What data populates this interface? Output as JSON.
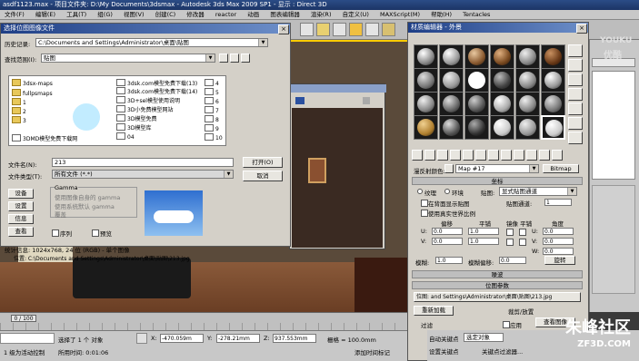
{
  "app": {
    "title": "asdf1123.max - 项目文件夹: D:\\My Documents\\3dsmax - Autodesk 3ds Max 2009 SP1 - 显示 : Direct 3D",
    "menu": [
      "文件(F)",
      "编辑(E)",
      "工具(T)",
      "组(G)",
      "视图(V)",
      "创建(C)",
      "修改器",
      "reactor",
      "动画",
      "图表编辑器",
      "渲染(R)",
      "自定义(U)",
      "MAXScript(M)",
      "帮助(H)",
      "Tentacles"
    ]
  },
  "file_dialog": {
    "title": "选择位图图像文件",
    "history_label": "历史记录:",
    "history_value": "C:\\Documents and Settings\\Administrator\\桌面\\贴图",
    "lookin_label": "查找范围(I):",
    "lookin_value": "贴图",
    "files": [
      "3dsx-maps",
      "fullpsmaps",
      "1",
      "2",
      "3",
      "3DMD模型免费下载网",
      "3dsk.com模型免费下载(13)",
      "3dsk.com模型免费下载(14)",
      "3D+sel模型使用说明",
      "3D小免费模型网站",
      "3D模型免费",
      "3D模型库",
      "04",
      "4",
      "5",
      "6",
      "7",
      "8",
      "9",
      "10"
    ],
    "filename_label": "文件名(N):",
    "filename_value": "213",
    "filetype_label": "文件类型(T):",
    "filetype_value": "所有文件 (*.*)",
    "open_btn": "打开(O)",
    "cancel_btn": "取消",
    "side_buttons": [
      "设备",
      "设置",
      "信息",
      "查看"
    ],
    "gamma_title": "Gamma",
    "gamma_options": [
      "使用图像自身的 gamma",
      "使用系统默认 gamma",
      "覆盖"
    ],
    "sequence_label": "序列",
    "preview_label": "预览",
    "stats_label": "统计信息: 1024x768, 24 位 (RGB) - 单个图像",
    "location_label": "位置: C:\\Documents and Settings\\Administrator\\桌面\\贴图\\213.jpg"
  },
  "material_editor": {
    "title": "材质编辑器 - 外景",
    "map_label": "漫反射颜色:",
    "map_name": "Map #17",
    "map_type": "Bitmap",
    "coords_rollout": "坐标",
    "texture_label": "纹理",
    "env_label": "环境",
    "mapping_label": "贴图:",
    "mapping_value": "显式贴图通道",
    "channel_label": "贴图通道:",
    "channel_value": "1",
    "show_back": "在背面显示贴图",
    "real_world": "使用真实世界比例",
    "offset_label": "偏移",
    "tiling_label": "平铺",
    "mirror_tile": "镜像 平铺",
    "angle_label": "角度",
    "u_label": "U:",
    "v_label": "V:",
    "w_label": "W:",
    "u_offset": "0.0",
    "v_offset": "0.0",
    "u_tiling": "1.0",
    "v_tiling": "1.0",
    "u_angle": "0.0",
    "v_angle": "0.0",
    "w_angle": "0.0",
    "blur_label": "模糊:",
    "blur_value": "1.0",
    "blur_offset_label": "模糊偏移:",
    "blur_offset_value": "0.0",
    "rotate_btn": "旋转",
    "noise_rollout": "噪波",
    "bitmap_rollout": "位图参数",
    "bitmap_path": "位图: and Settings\\Administrator\\桌面\\贴图\\213.jpg",
    "reload_btn": "重新加载",
    "crop_label": "裁剪/放置",
    "filter_label": "过滤",
    "apply_label": "应用",
    "view_image": "查看图像"
  },
  "status": {
    "frame": "0 / 100",
    "selected": "选择了 1 个 对象",
    "x": "-470.059m",
    "y": "-278.21mm",
    "z": "937.553mm",
    "grid": "栅格 = 100.0mm",
    "auto_key": "自动关键点",
    "set_key": "设置关键点",
    "selected_obj": "选定对象",
    "key_filter": "关键点过滤器...",
    "add_time_tag": "添加时间标记",
    "mode_label": "1 级为活动控制",
    "time_label": "所用时间: 0:01:06"
  },
  "watermarks": {
    "youku": "YOUKU",
    "youku_cn": "优酷",
    "zf_cn": "朱峰社区",
    "zf_url": "ZF3D.COM"
  }
}
